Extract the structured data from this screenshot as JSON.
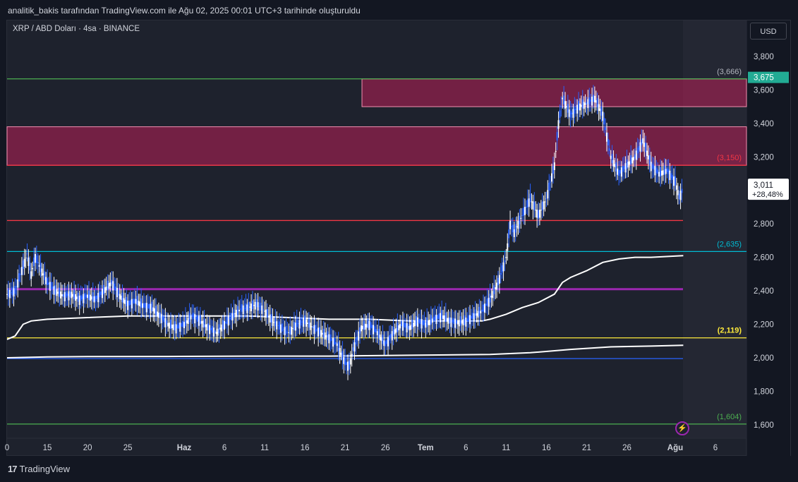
{
  "header": {
    "attribution": "analitik_bakis tarafından TradingView.com ile Ağu 02, 2025 00:01 UTC+3 tarihinde oluşturuldu"
  },
  "symbol": {
    "title": "XRP / ABD Doları · 4sa · BINANCE"
  },
  "currency_button": "USD",
  "footer": {
    "logo_text": "TradingView",
    "logo_mark": "17"
  },
  "current_price": {
    "value": "3,011",
    "change": "+28,48%"
  },
  "last_bar_price": "3,675",
  "bolt_icon": "⚡",
  "chart_data": {
    "type": "candlestick",
    "symbol": "XRP / ABD Doları",
    "interval": "4sa",
    "exchange": "BINANCE",
    "currency": "USD",
    "ylim": [
      1.55,
      3.95
    ],
    "y_ticks": [
      {
        "value": 3.8,
        "label": "3,800"
      },
      {
        "value": 3.6,
        "label": "3,600"
      },
      {
        "value": 3.4,
        "label": "3,400"
      },
      {
        "value": 3.2,
        "label": "3,200"
      },
      {
        "value": 2.8,
        "label": "2,800"
      },
      {
        "value": 2.6,
        "label": "2,600"
      },
      {
        "value": 2.4,
        "label": "2,400"
      },
      {
        "value": 2.2,
        "label": "2,200"
      },
      {
        "value": 2.0,
        "label": "2,000"
      },
      {
        "value": 1.8,
        "label": "1,800"
      },
      {
        "value": 1.6,
        "label": "1,600"
      }
    ],
    "x_ticks": [
      {
        "day": 10,
        "label": "0"
      },
      {
        "day": 15,
        "label": "15"
      },
      {
        "day": 20,
        "label": "20"
      },
      {
        "day": 25,
        "label": "25"
      },
      {
        "day": 32,
        "label": "Haz",
        "bold": true
      },
      {
        "day": 37,
        "label": "6"
      },
      {
        "day": 42,
        "label": "11"
      },
      {
        "day": 47,
        "label": "16"
      },
      {
        "day": 52,
        "label": "21"
      },
      {
        "day": 57,
        "label": "26"
      },
      {
        "day": 62,
        "label": "Tem",
        "bold": true
      },
      {
        "day": 67,
        "label": "6"
      },
      {
        "day": 72,
        "label": "11"
      },
      {
        "day": 77,
        "label": "16"
      },
      {
        "day": 82,
        "label": "21"
      },
      {
        "day": 87,
        "label": "26"
      },
      {
        "day": 93,
        "label": "Ağu",
        "bold": true
      },
      {
        "day": 98,
        "label": "6"
      }
    ],
    "x_range": [
      10,
      105
    ],
    "horizontal_levels": [
      {
        "value": 3.666,
        "label": "(3,666)",
        "color": "#4caf50",
        "label_color": "#b2b5be"
      },
      {
        "value": 3.15,
        "label": "(3,150)",
        "color": "#f23645",
        "label_color": "#f23645"
      },
      {
        "value": 2.82,
        "label": "",
        "color": "#f23645",
        "label_color": ""
      },
      {
        "value": 2.635,
        "label": "(2,635)",
        "color": "#00bcd4",
        "label_color": "#00bcd4"
      },
      {
        "value": 2.41,
        "label": "",
        "color": "#9c27b0",
        "label_color": ""
      },
      {
        "value": 2.119,
        "label": "(2,119)",
        "color": "#ffeb3b",
        "label_color": "#ffeb3b"
      },
      {
        "value": 1.995,
        "label": "",
        "color": "#2962ff",
        "label_color": ""
      },
      {
        "value": 1.604,
        "label": "(1,604)",
        "color": "#4caf50",
        "label_color": "#4caf50"
      }
    ],
    "zones": [
      {
        "from_day": 60,
        "to_day": 105,
        "low": 3.5,
        "high": 3.666,
        "color": "#e91e63"
      },
      {
        "from_day": 10,
        "to_day": 105,
        "low": 3.15,
        "high": 3.38,
        "color": "#e91e63"
      }
    ],
    "close_series": [
      [
        10,
        2.38
      ],
      [
        11,
        2.4
      ],
      [
        12,
        2.55
      ],
      [
        12.5,
        2.62
      ],
      [
        13,
        2.5
      ],
      [
        13.5,
        2.6
      ],
      [
        14,
        2.55
      ],
      [
        15,
        2.45
      ],
      [
        16,
        2.4
      ],
      [
        17,
        2.37
      ],
      [
        18,
        2.38
      ],
      [
        19,
        2.35
      ],
      [
        20,
        2.37
      ],
      [
        21,
        2.35
      ],
      [
        22,
        2.4
      ],
      [
        23,
        2.45
      ],
      [
        24,
        2.37
      ],
      [
        25,
        2.32
      ],
      [
        26,
        2.34
      ],
      [
        27,
        2.31
      ],
      [
        28,
        2.3
      ],
      [
        29,
        2.25
      ],
      [
        30,
        2.2
      ],
      [
        31,
        2.18
      ],
      [
        32,
        2.2
      ],
      [
        33,
        2.25
      ],
      [
        34,
        2.22
      ],
      [
        35,
        2.18
      ],
      [
        36,
        2.15
      ],
      [
        37,
        2.2
      ],
      [
        38,
        2.25
      ],
      [
        39,
        2.29
      ],
      [
        40,
        2.3
      ],
      [
        41,
        2.32
      ],
      [
        42,
        2.28
      ],
      [
        43,
        2.22
      ],
      [
        44,
        2.18
      ],
      [
        45,
        2.15
      ],
      [
        46,
        2.2
      ],
      [
        47,
        2.22
      ],
      [
        48,
        2.18
      ],
      [
        49,
        2.15
      ],
      [
        50,
        2.12
      ],
      [
        51,
        2.08
      ],
      [
        52,
        1.97
      ],
      [
        52.5,
        1.95
      ],
      [
        53,
        2.05
      ],
      [
        54,
        2.18
      ],
      [
        55,
        2.2
      ],
      [
        56,
        2.15
      ],
      [
        57,
        2.08
      ],
      [
        58,
        2.15
      ],
      [
        59,
        2.2
      ],
      [
        60,
        2.18
      ],
      [
        61,
        2.22
      ],
      [
        62,
        2.2
      ],
      [
        63,
        2.23
      ],
      [
        64,
        2.25
      ],
      [
        65,
        2.22
      ],
      [
        66,
        2.21
      ],
      [
        67,
        2.22
      ],
      [
        68,
        2.25
      ],
      [
        69,
        2.28
      ],
      [
        70,
        2.35
      ],
      [
        71,
        2.45
      ],
      [
        72,
        2.6
      ],
      [
        72.5,
        2.8
      ],
      [
        73,
        2.75
      ],
      [
        74,
        2.85
      ],
      [
        75,
        2.95
      ],
      [
        76,
        2.85
      ],
      [
        77,
        2.95
      ],
      [
        78,
        3.15
      ],
      [
        78.5,
        3.4
      ],
      [
        79,
        3.55
      ],
      [
        80,
        3.45
      ],
      [
        81,
        3.5
      ],
      [
        82,
        3.52
      ],
      [
        83,
        3.55
      ],
      [
        84,
        3.45
      ],
      [
        85,
        3.2
      ],
      [
        86,
        3.1
      ],
      [
        87,
        3.15
      ],
      [
        88,
        3.2
      ],
      [
        89,
        3.3
      ],
      [
        90,
        3.15
      ],
      [
        91,
        3.1
      ],
      [
        92,
        3.12
      ],
      [
        93,
        3.05
      ],
      [
        93.5,
        2.96
      ],
      [
        94,
        3.011
      ]
    ],
    "moving_average_1": [
      [
        10,
        2.11
      ],
      [
        11,
        2.13
      ],
      [
        12,
        2.2
      ],
      [
        13,
        2.22
      ],
      [
        15,
        2.23
      ],
      [
        20,
        2.24
      ],
      [
        25,
        2.25
      ],
      [
        30,
        2.25
      ],
      [
        35,
        2.25
      ],
      [
        40,
        2.25
      ],
      [
        45,
        2.24
      ],
      [
        50,
        2.23
      ],
      [
        55,
        2.23
      ],
      [
        60,
        2.22
      ],
      [
        65,
        2.22
      ],
      [
        69,
        2.22
      ],
      [
        70,
        2.23
      ],
      [
        72,
        2.26
      ],
      [
        74,
        2.3
      ],
      [
        76,
        2.33
      ],
      [
        78,
        2.38
      ],
      [
        79,
        2.45
      ],
      [
        80,
        2.48
      ],
      [
        82,
        2.52
      ],
      [
        84,
        2.57
      ],
      [
        86,
        2.59
      ],
      [
        88,
        2.6
      ],
      [
        90,
        2.6
      ],
      [
        94,
        2.61
      ]
    ],
    "moving_average_2": [
      [
        10,
        2.0
      ],
      [
        15,
        2.005
      ],
      [
        20,
        2.007
      ],
      [
        30,
        2.008
      ],
      [
        40,
        2.01
      ],
      [
        50,
        2.01
      ],
      [
        60,
        2.015
      ],
      [
        70,
        2.02
      ],
      [
        75,
        2.03
      ],
      [
        80,
        2.05
      ],
      [
        85,
        2.065
      ],
      [
        90,
        2.07
      ],
      [
        94,
        2.075
      ]
    ]
  }
}
